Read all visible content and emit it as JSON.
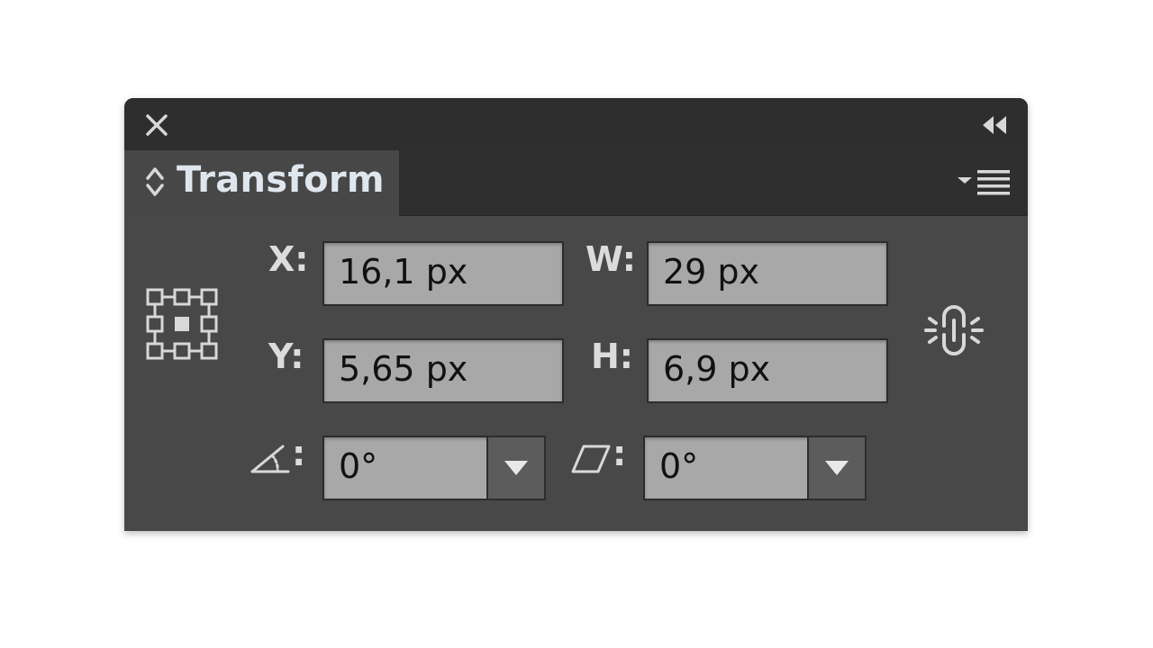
{
  "panel": {
    "tab_title": "Transform",
    "icons": {
      "close": "close-icon",
      "collapse": "collapse-double-arrow-icon",
      "tab_toggle": "up-down-chevron-icon",
      "panel_menu": "panel-menu-icon",
      "reference_point": "reference-point-grid-icon",
      "constrain": "chain-link-icon",
      "rotate": "rotate-angle-icon",
      "shear": "shear-icon",
      "dropdown": "triangle-down-icon"
    }
  },
  "fields": {
    "x": {
      "label": "X:",
      "value": "16,1 px"
    },
    "y": {
      "label": "Y:",
      "value": "5,65 px"
    },
    "w": {
      "label": "W:",
      "value": "29 px"
    },
    "h": {
      "label": "H:",
      "value": "6,9 px"
    },
    "rotate": {
      "label": ":",
      "value": "0°"
    },
    "shear": {
      "label": ":",
      "value": "0°"
    }
  },
  "colors": {
    "panel_bg": "#484848",
    "titlebar_bg": "#2e2e2e",
    "field_bg": "#a8a8a8",
    "label_text": "#dcdcdc"
  }
}
